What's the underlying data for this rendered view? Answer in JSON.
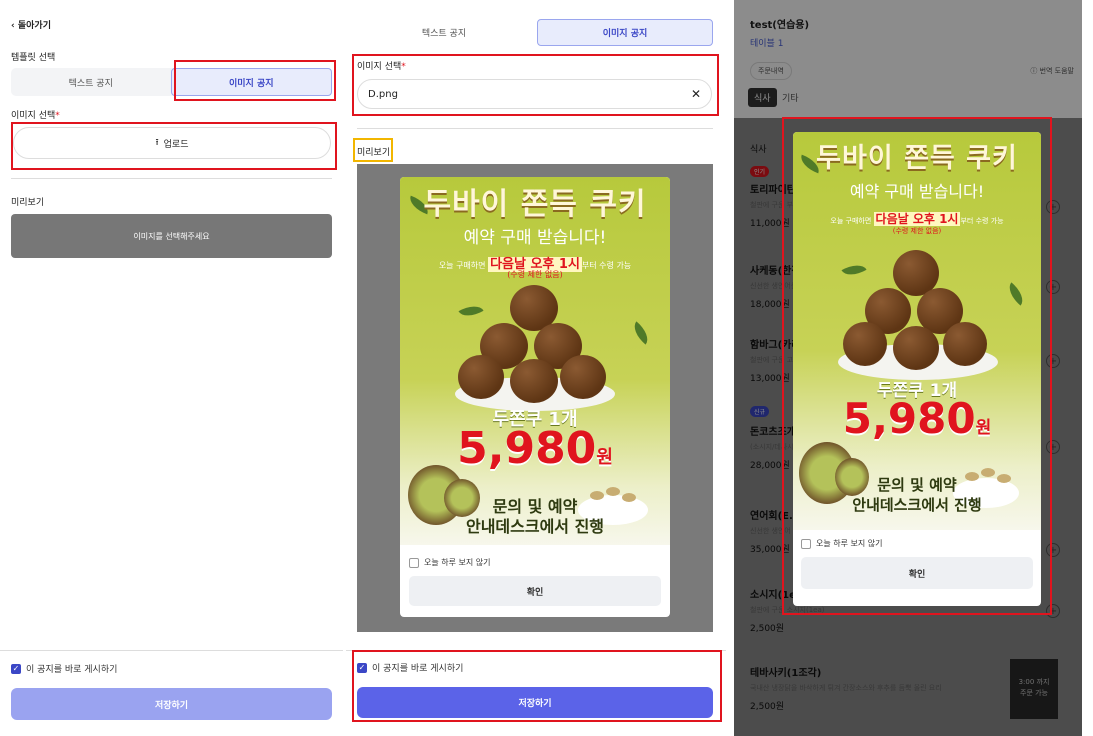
{
  "editor": {
    "back_label": "돌아가기",
    "template_label": "템플릿 선택",
    "tab_text": "텍스트 공지",
    "tab_image": "이미지 공지",
    "image_select_label": "이미지 선택",
    "required_mark": "*",
    "upload_label": "업로드",
    "preview_label": "미리보기",
    "preview_placeholder": "이미지를 선택해주세요",
    "publish_label": "이 공지를 바로 게시하기",
    "save_label": "저장하기",
    "selected_file": "D.png",
    "clear_symbol": "✕"
  },
  "poster": {
    "title": "두바이 쫀득 쿠키",
    "subtitle": "예약 구매 받습니다!",
    "line_pre": "오늘 구매하면",
    "line_highlight": "다음날 오후 1시",
    "line_post": "부터 수령 가능",
    "note": "(수령 제한 없음)",
    "product": "두쫀쿠 1개",
    "price": "5,980",
    "price_unit": "원",
    "contact_line1": "문의 및 예약",
    "contact_line2": "안내데스크에서 진행"
  },
  "popup": {
    "dont_show_today": "오늘 하루 보지 않기",
    "confirm": "확인"
  },
  "customer": {
    "store_name": "test(연습용)",
    "table_name": "테이블 1",
    "order_history": "주문내역",
    "translate": "번역 도움말",
    "tab_food": "식사",
    "tab_other": "기타",
    "section": "식사",
    "items": [
      {
        "badge": "인기",
        "name": "토리파이탄(",
        "desc": "철판에 구운 부",
        "price": "11,000원"
      },
      {
        "badge": "",
        "name": "사케동(한정",
        "desc": "신선한 생연어를",
        "price": "18,000원"
      },
      {
        "badge": "",
        "name": "함바그(카레",
        "desc": "철판에 구운 고소",
        "price": "13,000원"
      },
      {
        "badge": "신규",
        "name": "돈코츠조개",
        "desc": "(소시지/데사시",
        "price": "28,000원"
      },
      {
        "badge": "",
        "name": "연어회(E.코",
        "desc": "신선한 생연어",
        "price": "35,000원"
      },
      {
        "badge": "",
        "name": "소시지(1ea)",
        "desc": "철판에 구운 소시지(1ea)",
        "price": "2,500원"
      },
      {
        "badge": "",
        "name": "테바사키(1조각)",
        "desc": "국내산 냉장닭을 바삭하게 튀겨 간장소스와 후추를 듬뿍 올린 요리",
        "price": "2,500원"
      }
    ],
    "time_notice_line1": "3:00 까지",
    "time_notice_line2": "주문 가능"
  },
  "colors": {
    "accent": "#5b63e8",
    "accent_light": "#9aa3f0",
    "highlight_red": "#e0141e",
    "highlight_yellow": "#f2b600",
    "badge_red": "#e0141e",
    "badge_blue": "#3b47c6"
  }
}
